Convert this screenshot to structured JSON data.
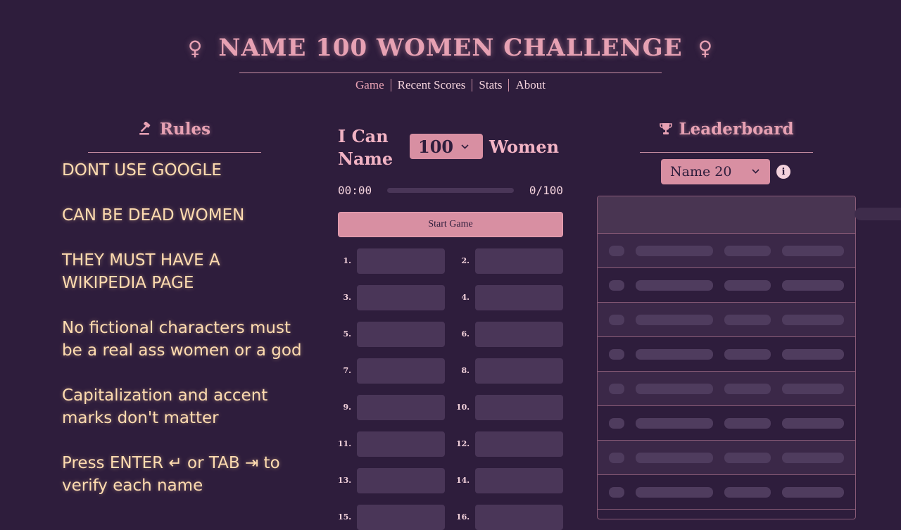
{
  "header": {
    "symbol_left": "♀",
    "title": "NAME 100 WOMEN CHALLENGE",
    "symbol_right": "♀"
  },
  "nav": [
    {
      "label": "Game",
      "active": true
    },
    {
      "label": "Recent Scores",
      "active": false
    },
    {
      "label": "Stats",
      "active": false
    },
    {
      "label": "About",
      "active": false
    }
  ],
  "rules": {
    "icon": "gavel-icon",
    "heading": "Rules",
    "items": [
      "DONT USE GOOGLE",
      "CAN BE DEAD WOMEN",
      "THEY MUST HAVE A WIKIPEDIA PAGE",
      "No fictional characters must be a real ass women or a god",
      "Capitalization and accent marks don't matter",
      "Press ENTER ↵ or TAB ⇥ to verify each name"
    ]
  },
  "game": {
    "prefix": "I Can Name",
    "count_selected": "100",
    "suffix": "Women",
    "timer": "00:00",
    "progress": 0,
    "score": "0/100",
    "start_label": "Start Game",
    "entry_numbers": [
      "1.",
      "2.",
      "3.",
      "4.",
      "5.",
      "6.",
      "7.",
      "8.",
      "9.",
      "10.",
      "11.",
      "12.",
      "13.",
      "14.",
      "15.",
      "16."
    ]
  },
  "leaderboard": {
    "icon": "trophy-icon",
    "heading": "Leaderboard",
    "filter_selected": "Name 20",
    "info_icon": "info-icon",
    "rows_loading": 8
  },
  "colors": {
    "background": "#2e1d3c",
    "accent": "#d88fa2",
    "rules_text": "#ffdcb0"
  }
}
